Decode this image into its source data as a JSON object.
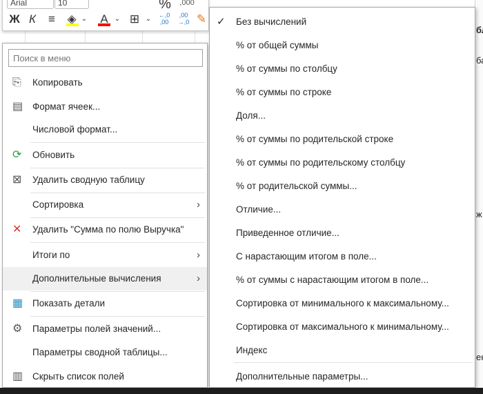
{
  "toolbar": {
    "font": "Arial",
    "size": "10",
    "bold": "Ж",
    "italic": "К",
    "percent": "%",
    "thousands": ",000",
    "font_color_letter": "A",
    "inc_decimal": "←,0 ,00",
    "dec_decimal": ",00 →,0"
  },
  "context_menu": {
    "search_placeholder": "Поиск в меню",
    "items": [
      {
        "label": "Копировать",
        "icon": "copy-icon"
      },
      {
        "label": "Формат ячеек...",
        "icon": "format-cells-icon"
      },
      {
        "label": "Числовой формат..."
      },
      {
        "label": "Обновить",
        "icon": "refresh-icon"
      },
      {
        "label": "Удалить сводную таблицу",
        "icon": "delete-pivot-icon"
      },
      {
        "label": "Сортировка",
        "submenu": true
      },
      {
        "label": "Удалить \"Сумма по полю Выручка\"",
        "icon": "delete-x-icon"
      },
      {
        "label": "Итоги по",
        "submenu": true
      },
      {
        "label": "Дополнительные вычисления",
        "submenu": true,
        "highlighted": true
      },
      {
        "label": "Показать детали",
        "icon": "show-details-icon"
      },
      {
        "label": "Параметры полей значений...",
        "icon": "field-settings-icon"
      },
      {
        "label": "Параметры сводной таблицы..."
      },
      {
        "label": "Скрыть список полей",
        "icon": "field-list-icon"
      }
    ]
  },
  "submenu": {
    "items": [
      {
        "label": "Без вычислений",
        "checked": true
      },
      {
        "label": "% от общей суммы"
      },
      {
        "label": "% от суммы по столбцу"
      },
      {
        "label": "% от суммы по строке"
      },
      {
        "label": "Доля..."
      },
      {
        "label": "% от суммы по родительской строке"
      },
      {
        "label": "% от суммы по родительскому столбцу"
      },
      {
        "label": "% от родительской суммы..."
      },
      {
        "label": "Отличие..."
      },
      {
        "label": "Приведенное отличие..."
      },
      {
        "label": "С нарастающим итогом в поле..."
      },
      {
        "label": "% от суммы с нарастающим итогом в поле..."
      },
      {
        "label": "Сортировка от минимального к максимальному..."
      },
      {
        "label": "Сортировка от максимального к минимальному..."
      },
      {
        "label": "Индекс"
      },
      {
        "label": "Дополнительные параметры..."
      }
    ]
  },
  "sheet_fragments": [
    "бл",
    "ба",
    "ж",
    "ен"
  ],
  "colors": {
    "highlight": "#f0f0f0",
    "fill_yellow": "#ffff00",
    "font_red": "#ff0000"
  }
}
